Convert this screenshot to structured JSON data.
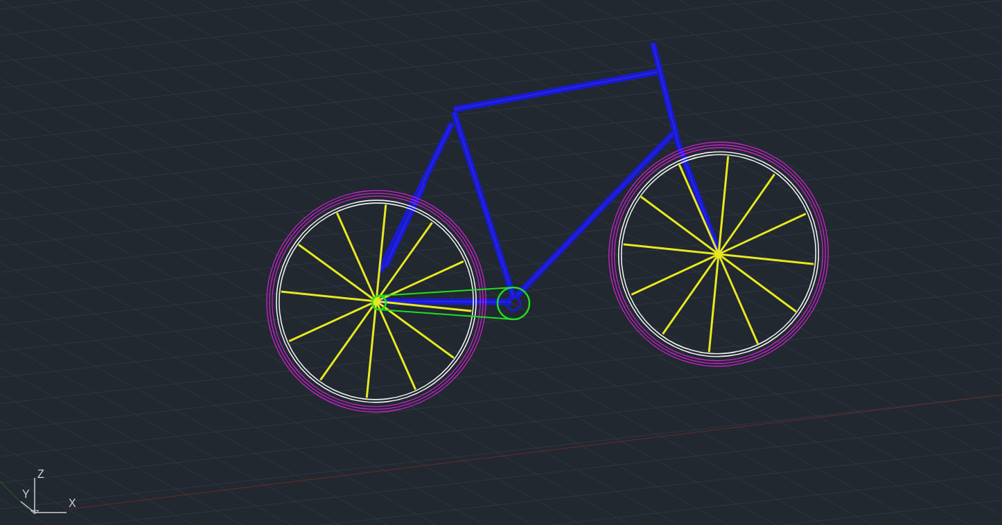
{
  "viewport": {
    "ucs_icon": {
      "labels": [
        "Z",
        "Y",
        "X"
      ]
    }
  }
}
